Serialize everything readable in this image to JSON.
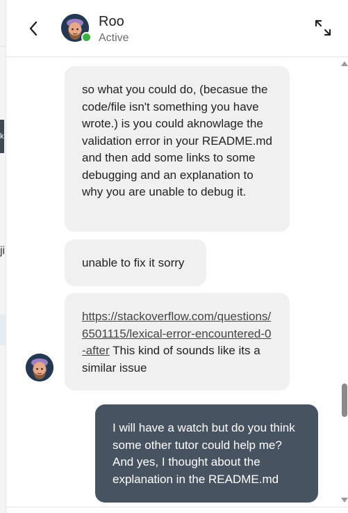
{
  "header": {
    "contact_name": "Roo",
    "status": "Active",
    "back_icon": "chevron-left-icon",
    "expand_icon": "expand-arrows-icon"
  },
  "background": {
    "tab_text": "k",
    "fragment_char": "ji"
  },
  "messages": [
    {
      "direction": "received",
      "text": "so what you could do, (becasue the code/file isn't something you have wrote.) is you could aknowlage the validation error in your README.md and then add some links to some debugging and an explanation to why you are unable to debug it."
    },
    {
      "direction": "received",
      "text": "unable to fix it sorry"
    },
    {
      "direction": "received",
      "link": "https://stackoverflow.com/questions/6501115/lexical-error-encountered-0-after",
      "text": " This kind of sounds like its a similar issue"
    },
    {
      "direction": "sent",
      "text": "I will have a watch but do you think some other tutor could help me? And yes, I thought about the explanation in the README.md"
    }
  ],
  "colors": {
    "sent_bubble": "#475361",
    "received_bubble": "#f0f0f0",
    "presence_active": "#3cb043"
  }
}
